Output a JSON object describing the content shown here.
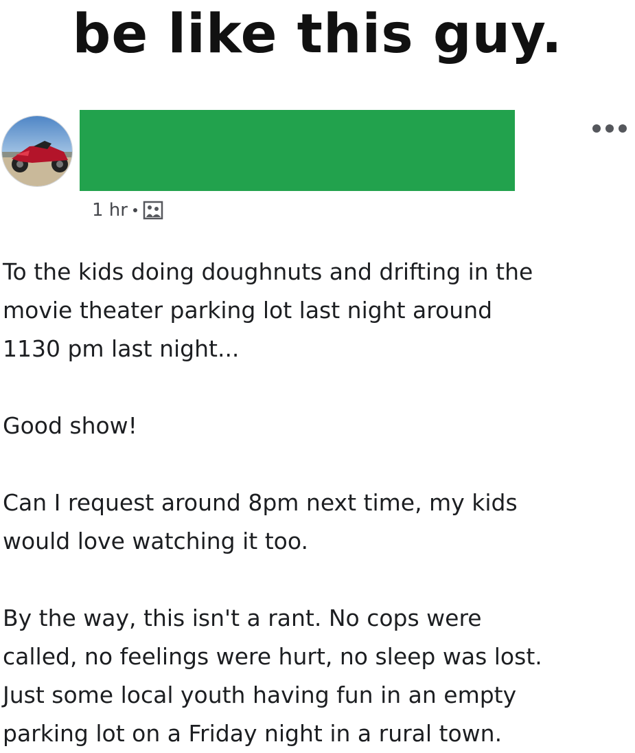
{
  "meme": {
    "title": "be like this guy."
  },
  "post": {
    "author_redacted": true,
    "redaction_color": "#22a24d",
    "avatar": "motorcycle-photo",
    "time": "1 hr",
    "privacy_icon": "public-photo-icon",
    "more_icon": "more-options-icon",
    "paragraphs": [
      "To the kids doing doughnuts and drifting in the\nmovie theater parking lot last night around\n1130 pm last night...",
      "Good show!",
      "Can I request around 8pm next time, my kids\nwould love watching it too.",
      "By the way, this isn't a rant.  No cops were\ncalled, no feelings were hurt, no sleep was lost.\nJust some local youth having fun in an empty\nparking lot on a Friday night in a rural town."
    ]
  }
}
